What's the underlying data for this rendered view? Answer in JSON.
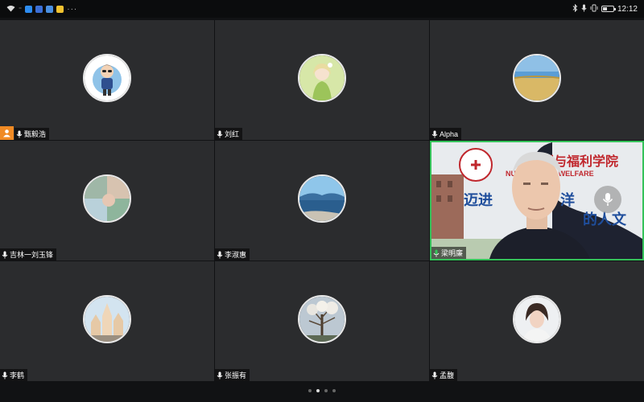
{
  "status_bar": {
    "time": "12:12",
    "left_icons": [
      "wifi-icon",
      "signal-icon",
      "app-icon-blue",
      "app-icon-blue2",
      "app-icon-yellow"
    ],
    "overflow": "···",
    "right_icons": [
      "bluetooth-icon",
      "mic-status-icon",
      "vibrate-icon",
      "battery-icon"
    ],
    "battery_level": 0.4
  },
  "participants": [
    {
      "name": "甄毅浩",
      "is_host": true,
      "avatar": "cartoon-boy-avatar"
    },
    {
      "name": "刘红",
      "is_host": false,
      "avatar": "anime-girl-avatar"
    },
    {
      "name": "Alpha",
      "is_host": false,
      "avatar": "field-landscape-avatar"
    },
    {
      "name": "吉林一刘玉锋",
      "is_host": false,
      "avatar": "collage-avatar"
    },
    {
      "name": "李淑惠",
      "is_host": false,
      "avatar": "lake-avatar"
    },
    {
      "name": "梁明廉",
      "is_host": false,
      "video_on": true,
      "active_speaker": true
    },
    {
      "name": "李鹤",
      "is_host": false,
      "avatar": "castle-avatar"
    },
    {
      "name": "张振有",
      "is_host": false,
      "avatar": "tree-avatar"
    },
    {
      "name": "孟馥",
      "is_host": false,
      "avatar": "woman-avatar"
    }
  ],
  "video_banner": {
    "line1": "护理与福利学院",
    "line2": "NURSING AND WELFARE",
    "line3": "迈进",
    "line4": "洋",
    "line5": "的人文"
  },
  "pagination": {
    "pages": 4,
    "current": 2
  },
  "colors": {
    "host_badge": "#f08a24",
    "active_border": "#35c25a",
    "tile_bg": "#2b2c2e"
  }
}
